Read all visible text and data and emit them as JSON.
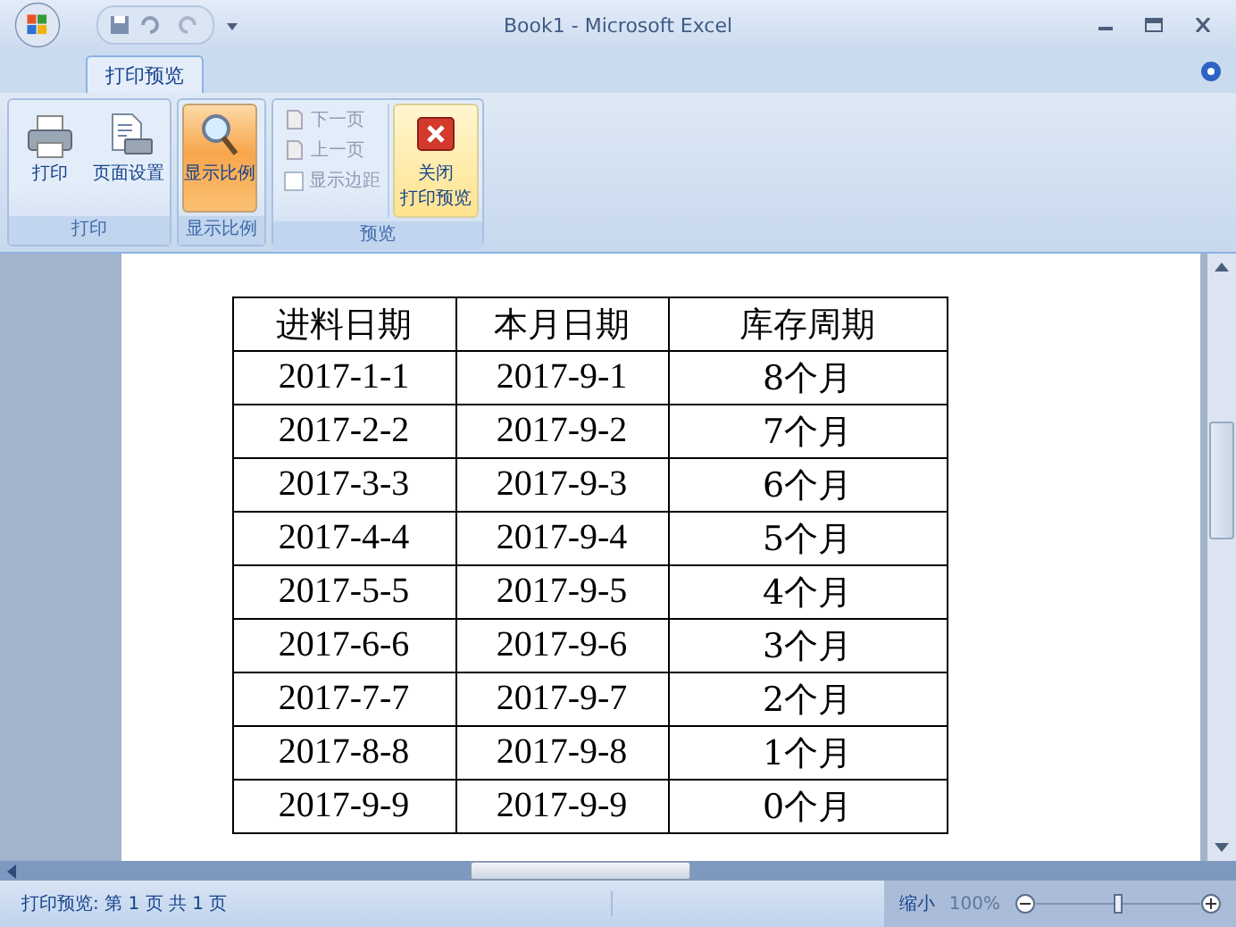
{
  "window": {
    "title": "Book1 - Microsoft Excel"
  },
  "tabs": [
    {
      "label": "打印预览",
      "selected": true
    }
  ],
  "ribbon_groups": [
    {
      "label": "打印",
      "items": [
        {
          "kind": "big",
          "lines": [
            "打印"
          ],
          "pressed": false,
          "hovered": false
        },
        {
          "kind": "big",
          "lines": [
            "页面设置"
          ],
          "pressed": false,
          "hovered": false
        }
      ]
    },
    {
      "label": "显示比例",
      "items": [
        {
          "kind": "big",
          "lines": [
            "显示比例"
          ],
          "pressed": true,
          "hovered": false
        }
      ]
    },
    {
      "label": "预览",
      "items": [
        {
          "kind": "small",
          "label": "下一页",
          "disabled": true
        },
        {
          "kind": "small",
          "label": "上一页",
          "disabled": true
        },
        {
          "kind": "check",
          "label": "显示边距",
          "checked": false,
          "disabled": true
        },
        {
          "kind": "big",
          "lines": [
            "关闭",
            "打印预览"
          ],
          "pressed": false,
          "hovered": true
        }
      ]
    }
  ],
  "sheet": {
    "columns": [
      "进料日期",
      "本月日期",
      "库存周期"
    ],
    "rows": [
      [
        "2017-1-1",
        "2017-9-1",
        "8个月"
      ],
      [
        "2017-2-2",
        "2017-9-2",
        "7个月"
      ],
      [
        "2017-3-3",
        "2017-9-3",
        "6个月"
      ],
      [
        "2017-4-4",
        "2017-9-4",
        "5个月"
      ],
      [
        "2017-5-5",
        "2017-9-5",
        "4个月"
      ],
      [
        "2017-6-6",
        "2017-9-6",
        "3个月"
      ],
      [
        "2017-7-7",
        "2017-9-7",
        "2个月"
      ],
      [
        "2017-8-8",
        "2017-9-8",
        "1个月"
      ],
      [
        "2017-9-9",
        "2017-9-9",
        "0个月"
      ]
    ]
  },
  "status_bar": {
    "text": "打印预览: 第 1 页  共 1 页",
    "zoom_out": "缩小",
    "zoom_value": "100%",
    "zoom_slider": {
      "level": 0.5
    }
  }
}
